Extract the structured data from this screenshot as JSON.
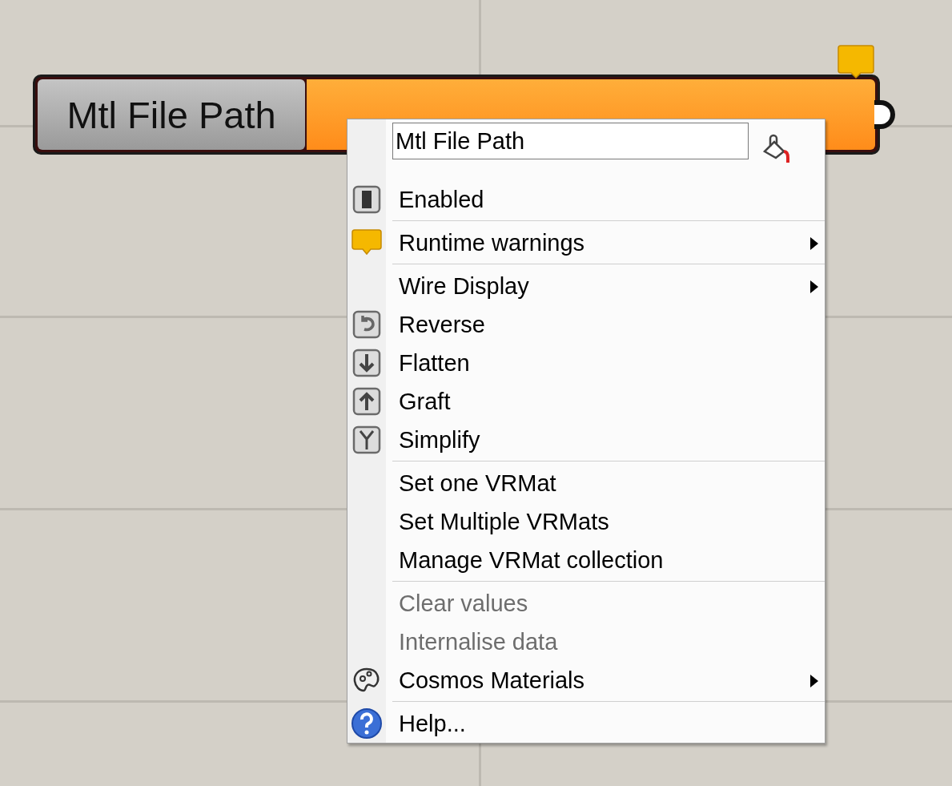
{
  "node": {
    "name": "Mtl File Path"
  },
  "menu": {
    "name_field": {
      "value": "Mtl File Path"
    },
    "sections": [
      {
        "items": [
          {
            "label": "Enabled",
            "kind": "toggle",
            "submenu": false,
            "disabled": false
          }
        ]
      },
      {
        "items": [
          {
            "label": "Runtime warnings",
            "kind": "warning",
            "submenu": true,
            "disabled": false
          }
        ]
      },
      {
        "items": [
          {
            "label": "Wire Display",
            "kind": "plain",
            "submenu": true,
            "disabled": false
          },
          {
            "label": "Reverse",
            "kind": "reverse",
            "submenu": false,
            "disabled": false
          },
          {
            "label": "Flatten",
            "kind": "flatten",
            "submenu": false,
            "disabled": false
          },
          {
            "label": "Graft",
            "kind": "graft",
            "submenu": false,
            "disabled": false
          },
          {
            "label": "Simplify",
            "kind": "simplify",
            "submenu": false,
            "disabled": false
          }
        ]
      },
      {
        "items": [
          {
            "label": "Set one VRMat",
            "kind": "plain",
            "submenu": false,
            "disabled": false
          },
          {
            "label": "Set Multiple VRMats",
            "kind": "plain",
            "submenu": false,
            "disabled": false
          },
          {
            "label": "Manage VRMat collection",
            "kind": "plain",
            "submenu": false,
            "disabled": false
          }
        ]
      },
      {
        "items": [
          {
            "label": "Clear values",
            "kind": "plain",
            "submenu": false,
            "disabled": true
          },
          {
            "label": "Internalise data",
            "kind": "plain",
            "submenu": false,
            "disabled": true
          },
          {
            "label": "Cosmos Materials",
            "kind": "palette",
            "submenu": true,
            "disabled": false
          }
        ]
      },
      {
        "items": [
          {
            "label": "Help...",
            "kind": "help",
            "submenu": false,
            "disabled": false
          }
        ]
      }
    ]
  }
}
